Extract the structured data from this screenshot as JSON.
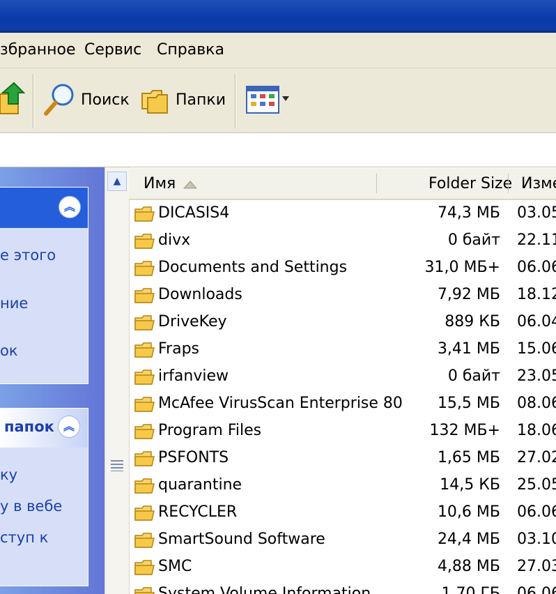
{
  "menu": [
    "збранное",
    "Сервис",
    "Справка"
  ],
  "toolbar": {
    "search_label": "Поиск",
    "folders_label": "Папки"
  },
  "left_panel": {
    "box1_links": [
      "е этого",
      "ние",
      "ок"
    ],
    "box2_title": "папок",
    "box2_links": [
      "ку",
      "у в вебе",
      "ступ к"
    ]
  },
  "columns": {
    "name": "Имя",
    "size": "Folder Size",
    "modified": "Измe"
  },
  "files": [
    {
      "name": "DICASIS4",
      "size": "74,3 МБ",
      "date": "03.05"
    },
    {
      "name": "divx",
      "size": "0 байт",
      "date": "22.11"
    },
    {
      "name": "Documents and Settings",
      "size": "31,0 МБ+",
      "date": "06.06"
    },
    {
      "name": "Downloads",
      "size": "7,92 МБ",
      "date": "18.12"
    },
    {
      "name": "DriveKey",
      "size": "889 КБ",
      "date": "06.04"
    },
    {
      "name": "Fraps",
      "size": "3,41 МБ",
      "date": "15.06"
    },
    {
      "name": "irfanview",
      "size": "0 байт",
      "date": "23.05"
    },
    {
      "name": "McAfee VirusScan Enterprise 80",
      "size": "15,5 МБ",
      "date": "08.06"
    },
    {
      "name": "Program Files",
      "size": "132 МБ+",
      "date": "18.06"
    },
    {
      "name": "PSFONTS",
      "size": "1,65 МБ",
      "date": "27.02"
    },
    {
      "name": "quarantine",
      "size": "14,5 КБ",
      "date": "25.05"
    },
    {
      "name": "RECYCLER",
      "size": "10,6 МБ",
      "date": "06.06"
    },
    {
      "name": "SmartSound Software",
      "size": "24,4 МБ",
      "date": "03.10"
    },
    {
      "name": "SMC",
      "size": "4,88 МБ",
      "date": "27.03"
    },
    {
      "name": "System Volume Information",
      "size": "1,70 ГБ",
      "date": "06.06"
    }
  ],
  "icons": {
    "up": "folder-up-icon",
    "search": "search-icon",
    "folders": "folders-icon",
    "views": "views-icon",
    "collapse": "collapse-chevrons-icon",
    "folder": "folder-icon",
    "sort": "sort-ascending-icon"
  },
  "colors": {
    "title_bar": "#0a3aa8",
    "chrome": "#ece9d8",
    "task_pane": "#6f8ee0",
    "link": "#1c3fb0"
  }
}
